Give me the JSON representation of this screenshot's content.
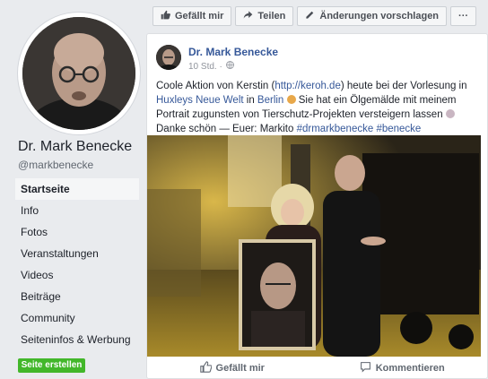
{
  "sidebar": {
    "page_name": "Dr. Mark Benecke",
    "handle": "@markbenecke",
    "nav": [
      {
        "label": "Startseite",
        "active": true
      },
      {
        "label": "Info"
      },
      {
        "label": "Fotos"
      },
      {
        "label": "Veranstaltungen"
      },
      {
        "label": "Videos"
      },
      {
        "label": "Beiträge"
      },
      {
        "label": "Community"
      },
      {
        "label": "Seiteninfos & Werbung"
      }
    ],
    "create_page": "Seite erstellen"
  },
  "actionbar": {
    "like": "Gefällt mir",
    "share": "Teilen",
    "suggest": "Änderungen vorschlagen",
    "more": "···"
  },
  "post": {
    "author": "Dr. Mark Benecke",
    "time": "10 Std. ·",
    "text_1": "Coole Aktion von Kerstin (",
    "link_1": "http://keroh.de",
    "text_2": ") heute bei der Vorlesung in ",
    "link_2": "Huxleys Neue Welt",
    "text_3": " in ",
    "link_3": "Berlin",
    "text_4": " Sie hat ein Ölgemälde mit meinem Portrait zugunsten von Tierschutz-Projekten versteigern lassen ",
    "text_5": " Danke schön — Euer: Markito ",
    "tag_1": "#drmarkbenecke",
    "tag_2": "#benecke"
  },
  "reactions": {
    "like": "Gefällt mir",
    "comment": "Kommentieren"
  },
  "colors": {
    "link": "#365899",
    "green": "#42b72a",
    "background": "#e9ebee"
  }
}
